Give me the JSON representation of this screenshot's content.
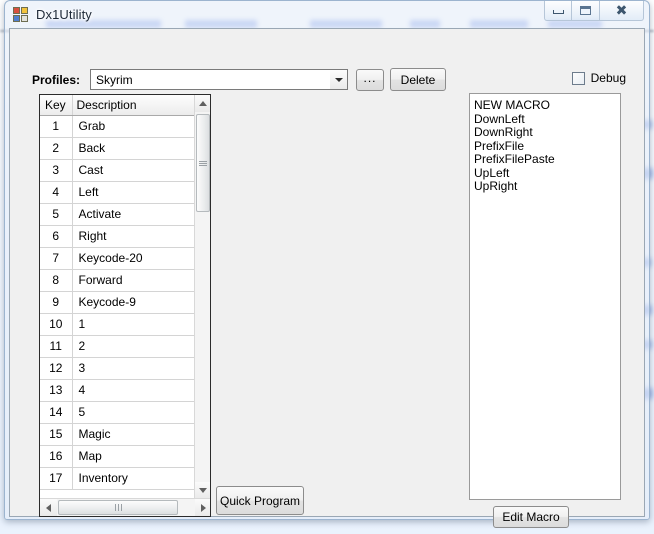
{
  "window": {
    "title": "Dx1Utility",
    "icon": "app-window-icon",
    "controls": {
      "minimize": "Minimize",
      "maximize": "Maximize",
      "close": "Close"
    }
  },
  "toolbar": {
    "profiles_label": "Profiles:",
    "profile_selected": "Skyrim",
    "profile_options": [
      "Skyrim"
    ],
    "browse_label": "...",
    "delete_label": "Delete",
    "debug_label": "Debug",
    "debug_checked": false
  },
  "key_grid": {
    "columns": [
      "Key",
      "Description"
    ],
    "rows": [
      {
        "key": "1",
        "description": "Grab"
      },
      {
        "key": "2",
        "description": "Back"
      },
      {
        "key": "3",
        "description": "Cast"
      },
      {
        "key": "4",
        "description": "Left"
      },
      {
        "key": "5",
        "description": "Activate"
      },
      {
        "key": "6",
        "description": "Right"
      },
      {
        "key": "7",
        "description": "Keycode-20"
      },
      {
        "key": "8",
        "description": "Forward"
      },
      {
        "key": "9",
        "description": "Keycode-9"
      },
      {
        "key": "10",
        "description": "1"
      },
      {
        "key": "11",
        "description": "2"
      },
      {
        "key": "12",
        "description": "3"
      },
      {
        "key": "13",
        "description": "4"
      },
      {
        "key": "14",
        "description": "5"
      },
      {
        "key": "15",
        "description": "Magic"
      },
      {
        "key": "16",
        "description": "Map"
      },
      {
        "key": "17",
        "description": "Inventory"
      }
    ]
  },
  "buttons": {
    "quick_program": "Quick Program",
    "edit_macro": "Edit Macro"
  },
  "macro_list": {
    "items": [
      "NEW MACRO",
      "DownLeft",
      "DownRight",
      "PrefixFile",
      "PrefixFilePaste",
      "UpLeft",
      "UpRight"
    ]
  },
  "colors": {
    "client_background": "#f0f0f0",
    "field_background": "#ffffff",
    "text": "#000000",
    "frame_border": "#9cb4cf"
  }
}
